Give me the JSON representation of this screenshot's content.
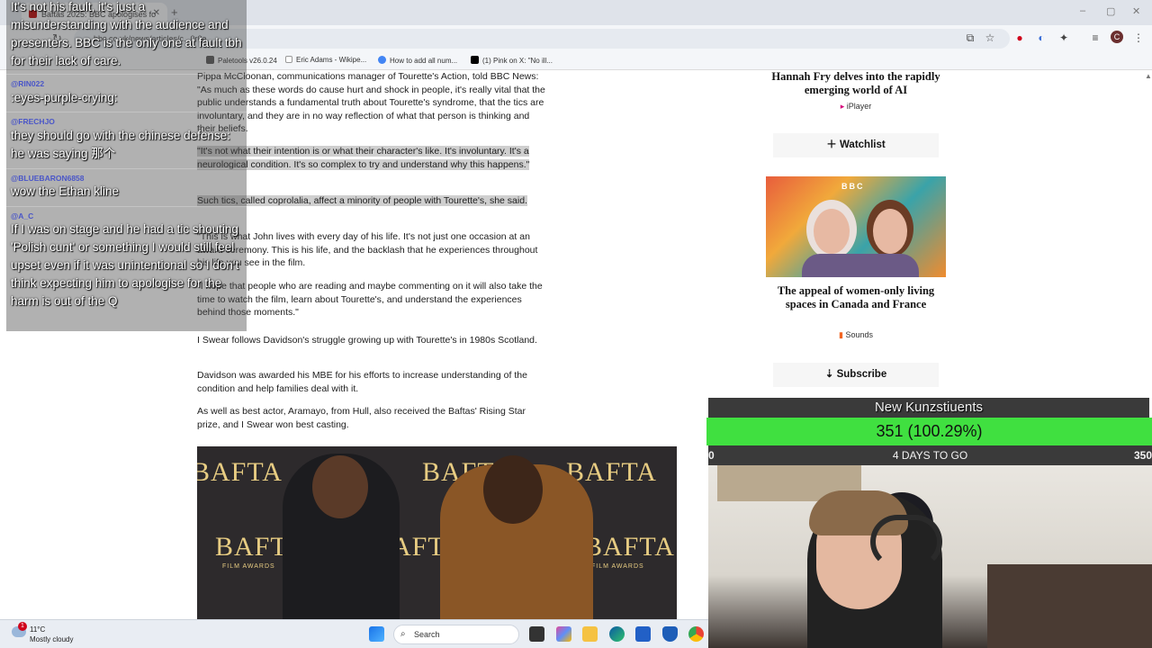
{
  "browser": {
    "tab_title": "Baftas 2025: BBC apologises fo",
    "url": "bbc.co.uk/news/articles/c...0r0a",
    "bookmarks": [
      {
        "label": "Paletools v26.0.24"
      },
      {
        "label": "Eric Adams - Wikipe..."
      },
      {
        "label": "How to add all num..."
      },
      {
        "label": "(1) Pink on X: \"No ill..."
      }
    ]
  },
  "article": {
    "paragraphs": [
      "Pippa McCloonan, communications manager of Tourette's Action, told BBC News: \"As much as these words do cause hurt and shock in people, it's really vital that the public understands a fundamental truth about Tourette's syndrome, that the tics are involuntary, and they are in no way reflection of what that person is thinking and their beliefs.",
      "\"It's not what their intention is or what their character's like. It's involuntary. It's a neurological condition. It's so complex to try and understand why this happens.\"",
      "Such tics, called coprolalia, affect a minority of people with Tourette's, she said.",
      "\"This is what John lives with every day of his life. It's not just one occasion at an award ceremony. This is his life, and the backlash that he experiences throughout his life you see in the film.",
      "\"I hope that people who are reading and maybe commenting on it will also take the time to watch the film, learn about Tourette's, and understand the experiences behind those moments.\"",
      "I Swear follows Davidson's struggle growing up with Tourette's in 1980s Scotland.",
      "Davidson was awarded his MBE for his efforts to increase understanding of the condition and help families deal with it.",
      "As well as best actor, Aramayo, from Hull, also received the Baftas' Rising Star prize, and I Swear won best casting."
    ],
    "photo_text": "BAFTA",
    "photo_subtext": "FILM AWARDS"
  },
  "sidebar": {
    "card1_title": "Hannah Fry delves into the rapidly emerging world of AI",
    "card1_tag": "iPlayer",
    "watchlist_label": "Watchlist",
    "card2_logo": "BBC",
    "card2_title": "The appeal of women-only living spaces in Canada and France",
    "card2_tag": "Sounds",
    "subscribe_label": "Subscribe"
  },
  "chat": {
    "messages": [
      {
        "user": "",
        "text": "It's not his fault, it's just a misunderstanding with the audience and presenters. BBC is the only one at fault tbh for their lack of care."
      },
      {
        "user": "@RIN022",
        "text": ":eyes-purple-crying:"
      },
      {
        "user": "@FRECHJO",
        "text": "they should go with the chinese defense: he was saying 那个"
      },
      {
        "user": "@BLUEBARON6858",
        "text": "wow the Ethan kline"
      },
      {
        "user": "@A_C",
        "text": "If I was on stage and he had a tic shouting 'Polish cunt' or something I would still feel upset even if it was unintentional so I don't think expecting him to apologise for the harm is out of the Q"
      }
    ]
  },
  "goal": {
    "title": "New Kunzstiuents",
    "value_text": "351 (100.29%)",
    "progress_fraction": 1.0,
    "left_label": "0",
    "center_label": "4 DAYS TO GO",
    "right_label": "350",
    "fill_color": "#40e040"
  },
  "taskbar": {
    "notification_count": "1",
    "weather_temp": "11°C",
    "weather_condition": "Mostly cloudy",
    "search_label": "Search"
  }
}
